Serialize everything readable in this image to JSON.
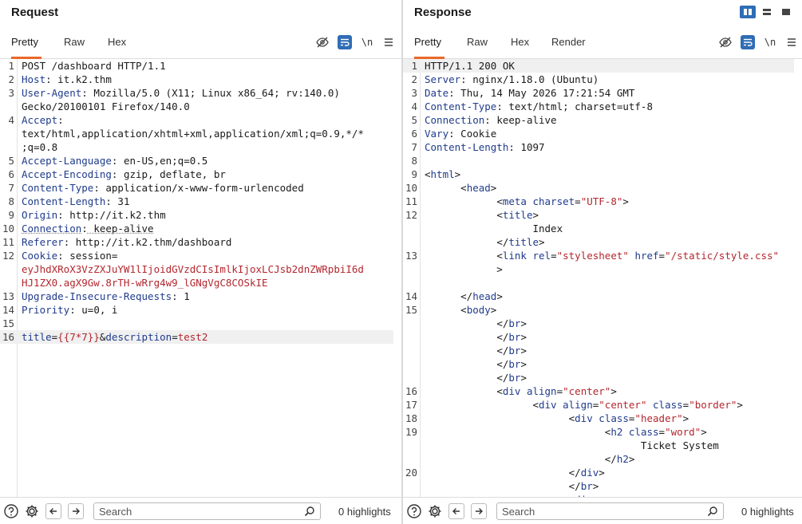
{
  "request": {
    "title": "Request",
    "tabs": [
      {
        "label": "Pretty"
      },
      {
        "label": "Raw"
      },
      {
        "label": "Hex"
      }
    ],
    "newline_label": "\\n",
    "lines": [
      {
        "n": "1",
        "text": "POST /dashboard HTTP/1.1"
      },
      {
        "n": "2",
        "key": "Host",
        "val": " it.k2.thm"
      },
      {
        "n": "3",
        "key": "User-Agent",
        "val": " Mozilla/5.0 (X11; Linux x86_64; rv:140.0)"
      },
      {
        "n": "",
        "text": "Gecko/20100101 Firefox/140.0"
      },
      {
        "n": "4",
        "key": "Accept",
        "val": ""
      },
      {
        "n": "",
        "text": "text/html,application/xhtml+xml,application/xml;q=0.9,*/*"
      },
      {
        "n": "",
        "text": ";q=0.8"
      },
      {
        "n": "5",
        "key": "Accept-Language",
        "val": " en-US,en;q=0.5"
      },
      {
        "n": "6",
        "key": "Accept-Encoding",
        "val": " gzip, deflate, br"
      },
      {
        "n": "7",
        "key": "Content-Type",
        "val": " application/x-www-form-urlencoded"
      },
      {
        "n": "8",
        "key": "Content-Length",
        "val": " 31"
      },
      {
        "n": "9",
        "key": "Origin",
        "val": " http://it.k2.thm"
      },
      {
        "n": "10",
        "key": "Connection",
        "val": " keep-alive"
      },
      {
        "n": "11",
        "key": "Referer",
        "val": " http://it.k2.thm/dashboard"
      },
      {
        "n": "12",
        "key": "Cookie",
        "val": " session="
      },
      {
        "n": "",
        "text": "eyJhdXRoX3VzZXJuYW1lIjoidGVzdCIsImlkIjoxLCJsb2dnZWRpbiI6d"
      },
      {
        "n": "",
        "text": "HJ1ZX0.agX9Gw.8rTH-wRrg4w9_lGNgVgC8COSkIE"
      },
      {
        "n": "13",
        "key": "Upgrade-Insecure-Requests",
        "val": " 1"
      },
      {
        "n": "14",
        "key": "Priority",
        "val": " u=0, i"
      },
      {
        "n": "15",
        "text": ""
      },
      {
        "n": "16",
        "body": {
          "p1": "title",
          "v1": "{{7*7}}",
          "p2": "description",
          "v2": "test2"
        }
      }
    ],
    "footer": {
      "search_placeholder": "Search",
      "highlights": "0 highlights"
    }
  },
  "response": {
    "title": "Response",
    "tabs": [
      {
        "label": "Pretty"
      },
      {
        "label": "Raw"
      },
      {
        "label": "Hex"
      },
      {
        "label": "Render"
      }
    ],
    "newline_label": "\\n",
    "lines": [
      {
        "n": "1",
        "text": "HTTP/1.1 200 OK"
      },
      {
        "n": "2",
        "key": "Server",
        "val": " nginx/1.18.0 (Ubuntu)"
      },
      {
        "n": "3",
        "key": "Date",
        "val": " Thu, 14 May 2026 17:21:54 GMT"
      },
      {
        "n": "4",
        "key": "Content-Type",
        "val": " text/html; charset=utf-8"
      },
      {
        "n": "5",
        "key": "Connection",
        "val": " keep-alive"
      },
      {
        "n": "6",
        "key": "Vary",
        "val": " Cookie"
      },
      {
        "n": "7",
        "key": "Content-Length",
        "val": " 1097"
      },
      {
        "n": "8",
        "text": ""
      },
      {
        "n": "9",
        "html": "<html>"
      },
      {
        "n": "10",
        "html": "      <head>"
      },
      {
        "n": "11",
        "html": "            <meta charset=\"UTF-8\">"
      },
      {
        "n": "12",
        "html": "            <title>"
      },
      {
        "n": "",
        "text": "                  Index"
      },
      {
        "n": "",
        "html": "            </title>"
      },
      {
        "n": "13",
        "html": "            <link rel=\"stylesheet\" href=\"/static/style.css\""
      },
      {
        "n": "",
        "text": "            >"
      },
      {
        "n": "",
        "text": ""
      },
      {
        "n": "14",
        "html": "      </head>"
      },
      {
        "n": "15",
        "html": "      <body>"
      },
      {
        "n": "",
        "html": "            </br>"
      },
      {
        "n": "",
        "html": "            </br>"
      },
      {
        "n": "",
        "html": "            </br>"
      },
      {
        "n": "",
        "html": "            </br>"
      },
      {
        "n": "",
        "html": "            </br>"
      },
      {
        "n": "16",
        "html": "            <div align=\"center\">"
      },
      {
        "n": "17",
        "html": "                  <div align=\"center\" class=\"border\">"
      },
      {
        "n": "18",
        "html": "                        <div class=\"header\">"
      },
      {
        "n": "19",
        "html": "                              <h2 class=\"word\">"
      },
      {
        "n": "",
        "text": "                                    Ticket System"
      },
      {
        "n": "",
        "html": "                              </h2>"
      },
      {
        "n": "20",
        "html": "                        </div>"
      },
      {
        "n": "",
        "html": "                        </br>"
      },
      {
        "n": "",
        "html": "                        <div>"
      }
    ],
    "footer": {
      "search_placeholder": "Search",
      "highlights": "0 highlights"
    }
  },
  "colors": {
    "accent": "#e8692a",
    "wrap_button": "#2f6db5",
    "layout_toggle_active": "#2f6db5"
  },
  "icons": [
    "eye-off-icon",
    "wrap-icon",
    "menu-icon",
    "help-icon",
    "gear-icon",
    "back-arrow-icon",
    "forward-arrow-icon",
    "search-icon",
    "layout-side-by-side-icon",
    "layout-stacked-icon",
    "layout-tabs-icon"
  ]
}
